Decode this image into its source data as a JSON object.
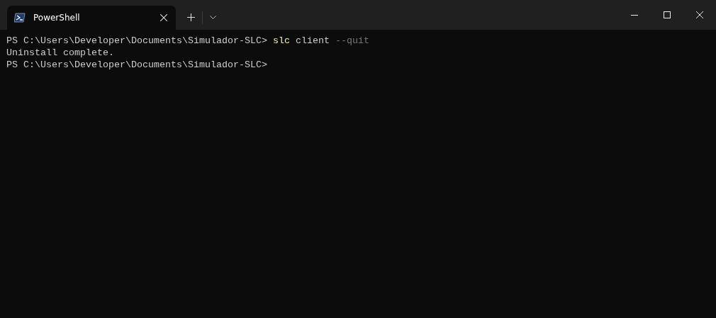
{
  "tabs": [
    {
      "title": "PowerShell",
      "selected": true
    }
  ],
  "terminal": {
    "lines": [
      [
        {
          "kind": "prompt",
          "text": "PS C:\\Users\\Developer\\Documents\\Simulador-SLC> "
        },
        {
          "kind": "command",
          "text": "slc"
        },
        {
          "kind": "plain",
          "text": " client "
        },
        {
          "kind": "parameter",
          "text": "--quit"
        }
      ],
      [
        {
          "kind": "plain",
          "text": "Uninstall complete."
        }
      ],
      [
        {
          "kind": "prompt",
          "text": "PS C:\\Users\\Developer\\Documents\\Simulador-SLC>"
        }
      ]
    ]
  }
}
